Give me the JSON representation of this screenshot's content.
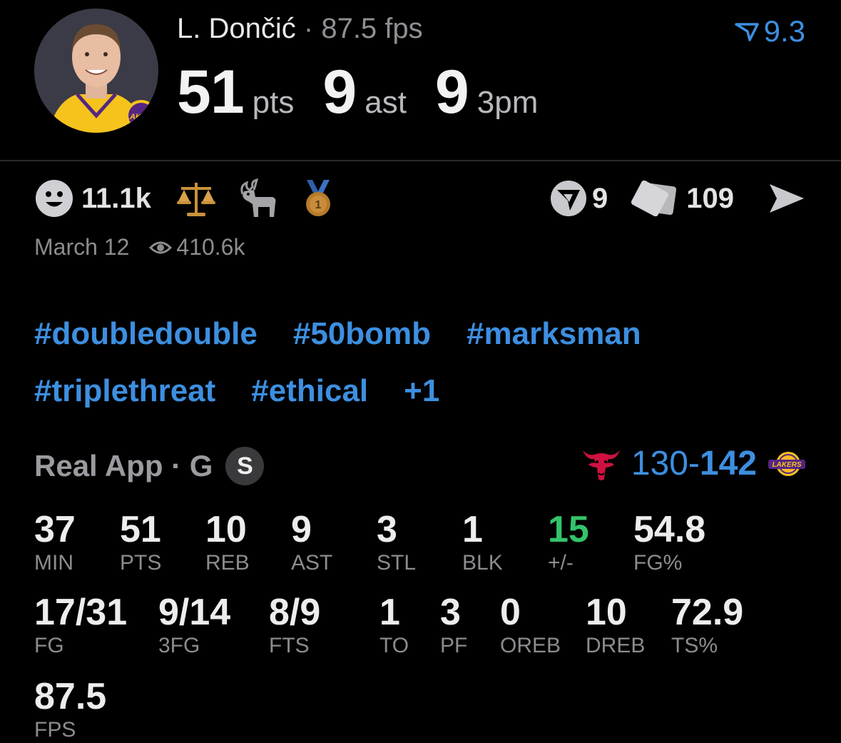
{
  "header": {
    "player_name": "L. Dončić",
    "separator": "·",
    "fps_text": "87.5 fps",
    "rating": "9.3",
    "rating_icon": "rating-arrow-icon",
    "big_stats": [
      {
        "value": "51",
        "unit": "pts"
      },
      {
        "value": "9",
        "unit": "ast"
      },
      {
        "value": "9",
        "unit": "3pm"
      }
    ]
  },
  "reactions": {
    "smiley_count": "11.1k",
    "badges": [
      "scales-icon",
      "goat-icon",
      "medal-icon"
    ],
    "votes": "9",
    "cards": "109",
    "date": "March 12",
    "views": "410.6k"
  },
  "tags": {
    "row1": [
      "#doubledouble",
      "#50bomb",
      "#marksman"
    ],
    "row2": [
      "#triplethreat",
      "#ethical",
      "+1"
    ]
  },
  "game": {
    "label": "Real App · G",
    "badge": "S",
    "score_left": "130",
    "score_dash": "-",
    "score_right": "142"
  },
  "stats": {
    "row1": [
      {
        "value": "37",
        "label": "MIN"
      },
      {
        "value": "51",
        "label": "PTS"
      },
      {
        "value": "10",
        "label": "REB"
      },
      {
        "value": "9",
        "label": "AST"
      },
      {
        "value": "3",
        "label": "STL"
      },
      {
        "value": "1",
        "label": "BLK"
      },
      {
        "value": "15",
        "label": "+/-"
      },
      {
        "value": "54.8",
        "label": "FG%"
      }
    ],
    "row2": [
      {
        "value": "17/31",
        "label": "FG"
      },
      {
        "value": "9/14",
        "label": "3FG"
      },
      {
        "value": "8/9",
        "label": "FTS"
      },
      {
        "value": "1",
        "label": "TO"
      },
      {
        "value": "3",
        "label": "PF"
      },
      {
        "value": "0",
        "label": "OREB"
      },
      {
        "value": "10",
        "label": "DREB"
      },
      {
        "value": "72.9",
        "label": "TS%"
      }
    ],
    "row3": [
      {
        "value": "87.5",
        "label": "FPS"
      }
    ]
  },
  "colors": {
    "accent_blue": "#3d8fe0",
    "positive_green": "#34c46a",
    "background": "#000000"
  }
}
